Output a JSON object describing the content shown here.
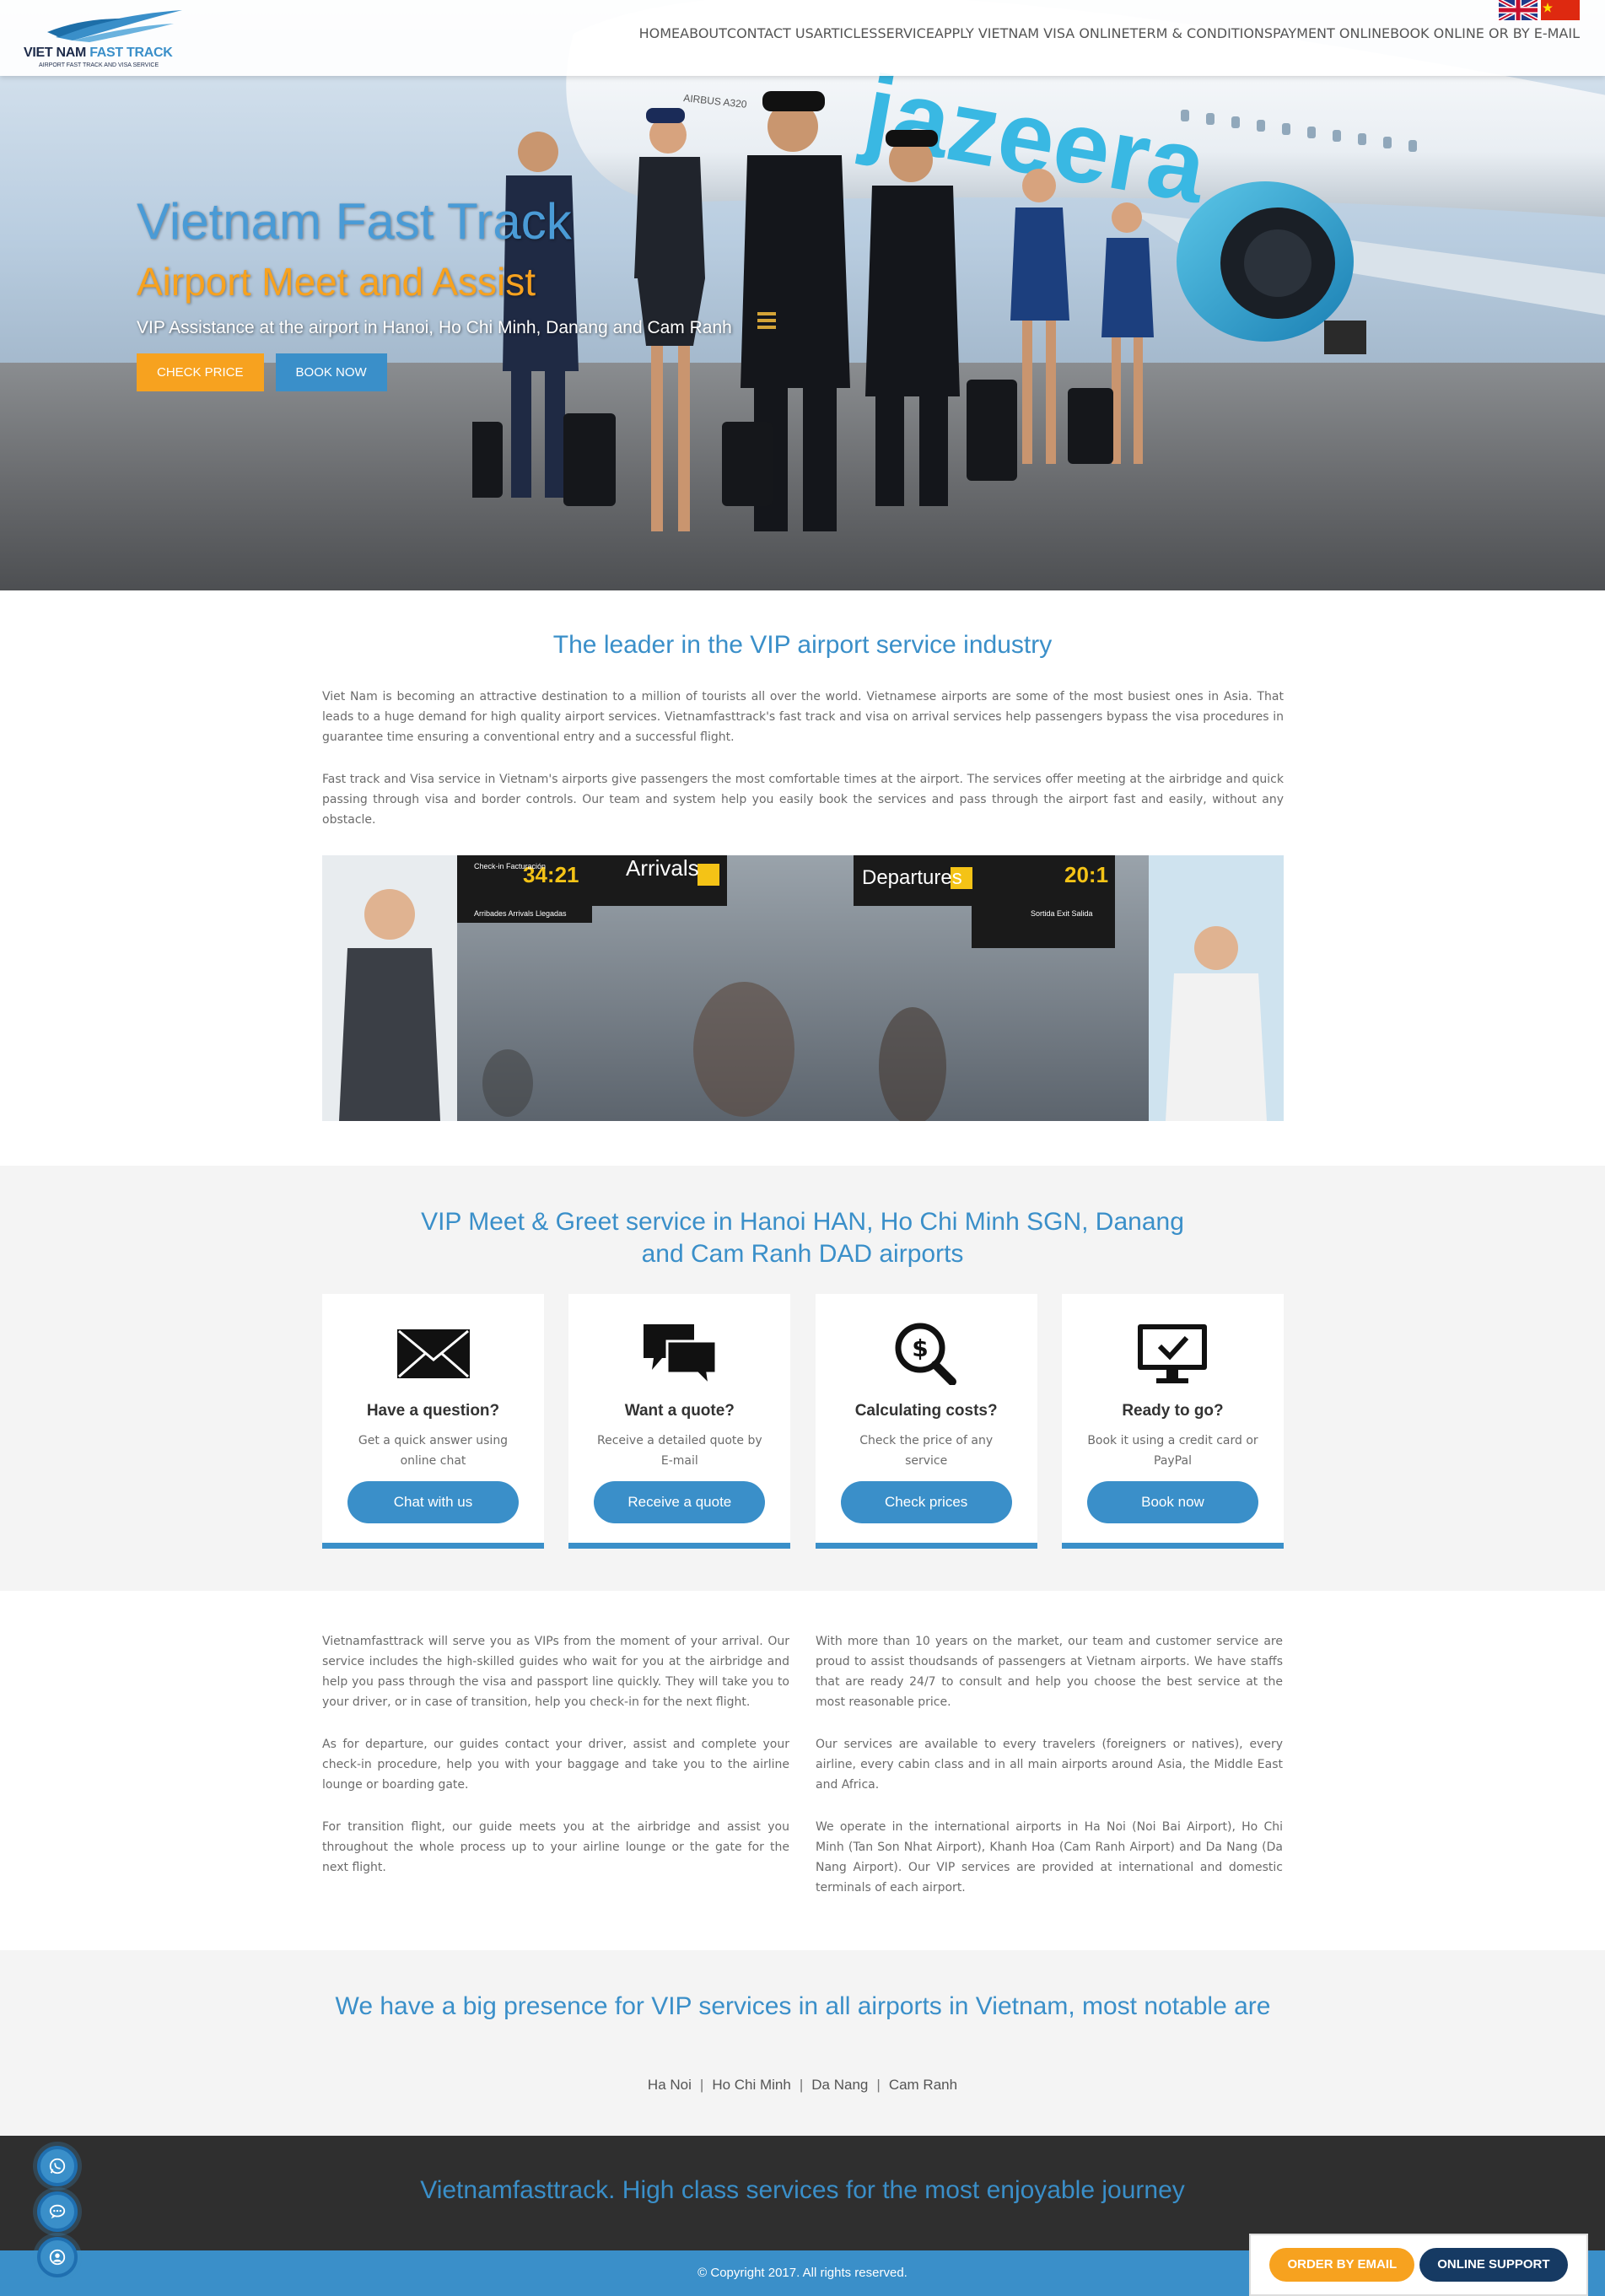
{
  "logo": {
    "brand_main": "VIET NAM",
    "brand_accent": "FAST TRACK",
    "tagline": "AIRPORT FAST TRACK AND VISA SERVICE"
  },
  "nav": {
    "items": [
      {
        "label": "HOME"
      },
      {
        "label": "ABOUT"
      },
      {
        "label": "CONTACT US"
      },
      {
        "label": "ARTICLES"
      },
      {
        "label": "SERVICE"
      },
      {
        "label": "APPLY VIETNAM VISA ONLINE"
      },
      {
        "label": "TERM & CONDITIONS"
      },
      {
        "label": "PAYMENT ONLINE"
      }
    ],
    "book_button": "BOOK ONLINE OR BY E-MAIL"
  },
  "hero": {
    "title": "Vietnam Fast Track",
    "subtitle": "Airport Meet and Assist",
    "description": "VIP Assistance at the airport in Hanoi, Ho Chi Minh, Danang and Cam Ranh",
    "check_price": "CHECK PRICE",
    "book_now": "BOOK NOW",
    "plane_livery": "jazeera",
    "plane_model": "AIRBUS A320"
  },
  "leader": {
    "title": "The leader in the VIP airport service industry",
    "paragraph1": "Viet Nam is becoming an attractive destination to a million of tourists all over the world. Vietnamese airports are some of the most busiest ones in Asia. That leads to a huge demand for high quality airport services. Vietnamfasttrack's fast track and visa on arrival services help passengers bypass the visa procedures in guarantee time ensuring a conventional entry and a successful flight.",
    "paragraph2": "Fast track and Visa service in Vietnam's airports give passengers the most comfortable times at the airport. The services offer meeting at the airbridge and quick passing through visa and border controls. Our team and system help you easily book the services and pass through the airport fast and easily, without any obstacle.",
    "signs": {
      "arrivals": "Arrivals",
      "departures": "Departures",
      "gate_left": "34:21",
      "gate_right": "20:1",
      "checkin": "Check-in Facturación",
      "arribadas": "Arribades Arrivals Llegadas",
      "sortida": "Sortida Exit Salida"
    }
  },
  "meet_greet": {
    "title": "VIP Meet & Greet service in Hanoi HAN, Ho Chi Minh SGN, Danang and Cam Ranh DAD airports",
    "cards": [
      {
        "icon": "envelope-icon",
        "title": "Have a question?",
        "desc": "Get a quick answer using online chat",
        "button": "Chat with us"
      },
      {
        "icon": "chat-bubbles-icon",
        "title": "Want a quote?",
        "desc": "Receive a detailed quote by E-mail",
        "button": "Receive a quote"
      },
      {
        "icon": "dollar-search-icon",
        "title": "Calculating costs?",
        "desc": "Check the price of any service",
        "button": "Check prices"
      },
      {
        "icon": "monitor-check-icon",
        "title": "Ready to go?",
        "desc": "Book it using a credit card or PayPal",
        "button": "Book now"
      }
    ]
  },
  "about": {
    "left": [
      "Vietnamfasttrack will serve you as VIPs from the moment of your arrival. Our service includes the high-skilled guides who wait for you at the airbridge and help you pass through the visa and passport line quickly. They will take you to your driver, or in case of transition, help you check-in for the next flight.",
      "As for departure, our guides contact your driver, assist and complete your check-in procedure, help you with your baggage and take you to the airline lounge or boarding gate.",
      "For transition flight, our guide meets you at the airbridge and assist you throughout the whole process up to your airline lounge or the gate for the next flight."
    ],
    "right": [
      "With more than 10 years on the market, our team and customer service are proud to assist thoudsands of passengers at Vietnam airports. We have staffs that are ready 24/7 to consult and help you choose the best service at the most reasonable price.",
      "Our services are available to every travelers (foreigners or natives), every airline, every cabin class and in all main airports around Asia, the Middle East and Africa.",
      "We operate in the international airports in Ha Noi (Noi Bai Airport), Ho Chi Minh (Tan Son Nhat Airport), Khanh Hoa (Cam Ranh Airport) and Da Nang (Da Nang Airport). Our VIP services are provided at international and domestic terminals of each airport."
    ]
  },
  "presence": {
    "title": "We have a big presence for VIP services in all airports in Vietnam, most notable are",
    "airports": [
      "Ha Noi",
      "Ho Chi Minh",
      "Da Nang",
      "Cam Ranh"
    ],
    "separator": "|"
  },
  "footer": {
    "tagline": "Vietnamfasttrack. High class services for the most enjoyable journey",
    "copyright": "© Copyright 2017. All rights reserved."
  },
  "support": {
    "order_email": "ORDER BY EMAIL",
    "online_support": "ONLINE SUPPORT"
  },
  "floating": {
    "icons": [
      "whatsapp-icon",
      "chat-icon",
      "user-circle-icon"
    ]
  },
  "colors": {
    "brand_blue": "#3a8fc9",
    "accent_orange": "#f7a21f",
    "navy": "#163a63",
    "footer_dark": "#2f2f2f",
    "section_gray": "#f4f4f4"
  }
}
